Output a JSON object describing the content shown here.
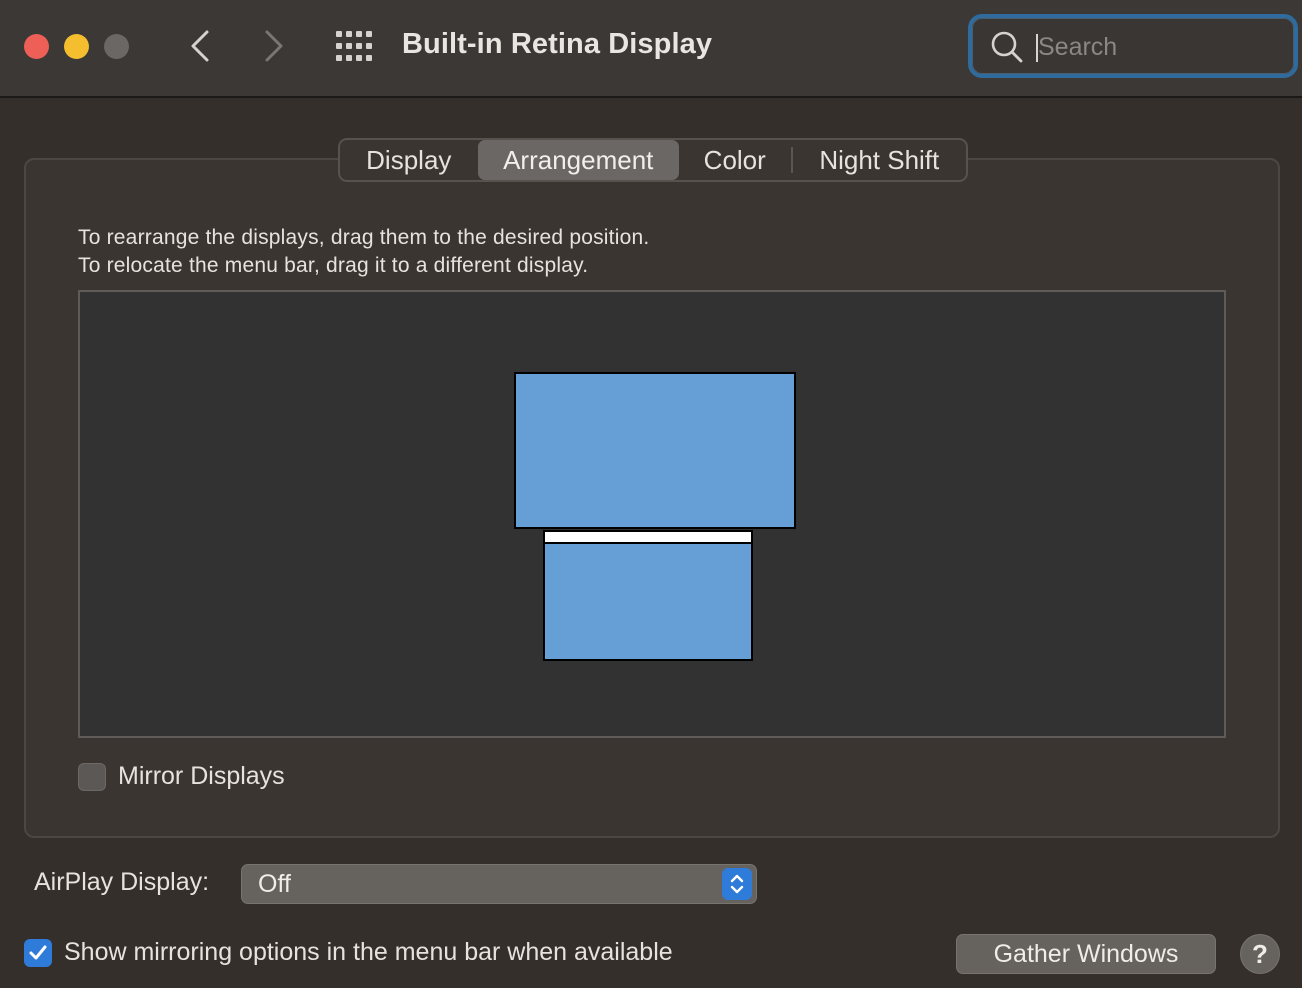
{
  "window": {
    "title": "Built-in Retina Display"
  },
  "search": {
    "placeholder": "Search",
    "value": ""
  },
  "icons": {
    "close": "close-button",
    "minimize": "minimize-button",
    "zoom": "zoom-button-disabled",
    "back": "chevron-left-icon",
    "forward": "chevron-right-icon",
    "all_prefs": "grid-icon",
    "search": "magnifying-glass-icon"
  },
  "tabs": [
    {
      "label": "Display",
      "selected": false
    },
    {
      "label": "Arrangement",
      "selected": true
    },
    {
      "label": "Color",
      "selected": false
    },
    {
      "label": "Night Shift",
      "selected": false
    }
  ],
  "arrangement": {
    "instruction_line1": "To rearrange the displays, drag them to the desired position.",
    "instruction_line2": "To relocate the menu bar, drag it to a different display."
  },
  "mirror": {
    "label": "Mirror Displays",
    "checked": false
  },
  "airplay": {
    "label": "AirPlay Display:",
    "value": "Off"
  },
  "show_mirroring": {
    "label": "Show mirroring options in the menu bar when available",
    "checked": true
  },
  "buttons": {
    "gather": "Gather Windows",
    "help": "?"
  },
  "colors": {
    "accent": "#2f7bd9",
    "display_fill": "#659fd6",
    "close": "#ed5f57",
    "minimize": "#f5be2f",
    "focus_ring": "#2f6b9c"
  }
}
